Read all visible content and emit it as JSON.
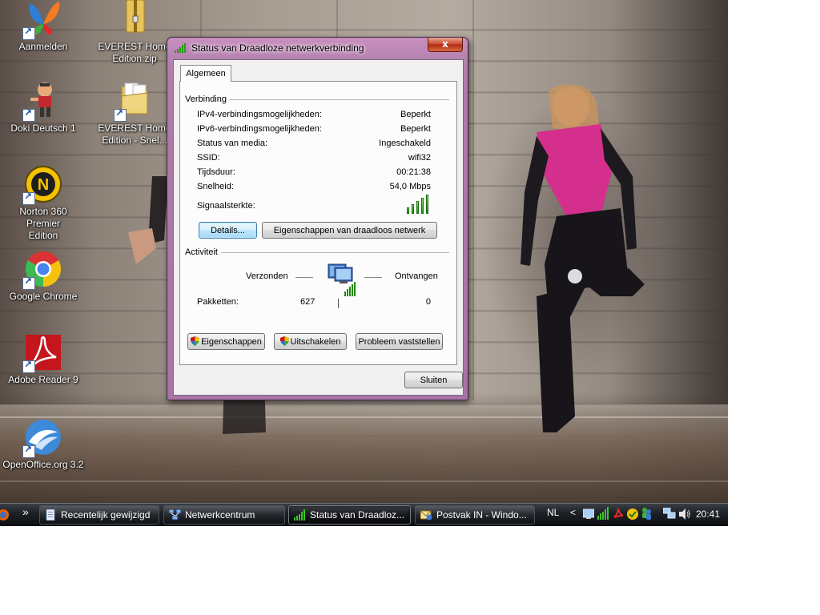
{
  "desktop": {
    "icons": [
      {
        "label": "Aanmelden",
        "icon": "msn-butterfly-icon"
      },
      {
        "label": "EVEREST Home Edition.zip",
        "line1": "EVEREST Home",
        "line2": "Edition.zip",
        "icon": "zip-folder-icon"
      },
      {
        "label": "Doki Deutsch 1",
        "icon": "cartoon-character-icon"
      },
      {
        "label": "EVEREST Home Edition - Snel...",
        "line1": "EVEREST Home",
        "line2": "Edition - Snel...",
        "icon": "folder-icon"
      },
      {
        "label": "Norton 360 Premier Edition",
        "line1": "Norton 360 Premier",
        "line2": "Edition",
        "icon": "norton-icon"
      },
      {
        "label": "Google Chrome",
        "icon": "chrome-icon"
      },
      {
        "label": "Adobe Reader 9",
        "icon": "adobe-reader-icon"
      },
      {
        "label": "OpenOffice.org 3.2",
        "icon": "openoffice-icon"
      }
    ]
  },
  "dialog": {
    "title": "Status van Draadloze netwerkverbinding",
    "close_symbol": "x",
    "tab_label": "Algemeen",
    "connection": {
      "group_title": "Verbinding",
      "rows": [
        {
          "key": "IPv4-verbindingsmogelijkheden:",
          "value": "Beperkt"
        },
        {
          "key": "IPv6-verbindingsmogelijkheden:",
          "value": "Beperkt"
        },
        {
          "key": "Status van media:",
          "value": "Ingeschakeld"
        },
        {
          "key": "SSID:",
          "value": "wifi32"
        },
        {
          "key": "Tijdsduur:",
          "value": "00:21:38"
        },
        {
          "key": "Snelheid:",
          "value": "54,0 Mbps"
        }
      ],
      "signal_label": "Signaalsterkte:",
      "signal_bars_lit": 5,
      "signal_bars_total": 5
    },
    "details_button": "Details...",
    "wireless_props_button": "Eigenschappen van draadloos netwerk",
    "activity": {
      "group_title": "Activiteit",
      "sent_label": "Verzonden",
      "received_label": "Ontvangen",
      "packets_label": "Pakketten:",
      "packets_sent": "627",
      "packets_received": "0"
    },
    "properties_button": "Eigenschappen",
    "disable_button": "Uitschakelen",
    "diagnose_button": "Probleem vaststellen",
    "close_button": "Sluiten"
  },
  "taskbar": {
    "overflow_symbol": "»",
    "buttons": [
      {
        "label": "Recentelijk gewijzigd",
        "icon": "document-icon",
        "active": false
      },
      {
        "label": "Netwerkcentrum",
        "icon": "network-center-icon",
        "active": false
      },
      {
        "label": "Status van Draadloz...",
        "icon": "wireless-signal-icon",
        "active": true
      },
      {
        "label": "Postvak IN - Windo...",
        "icon": "windows-mail-icon",
        "active": false
      }
    ],
    "language": "NL",
    "tray_expand": "<",
    "clock": "20:41"
  },
  "colors": {
    "window_frame": "#b583b0",
    "taskbar": "#1c1f24",
    "signal_green": "#1f8c12",
    "default_button_border": "#3c7fb1"
  }
}
